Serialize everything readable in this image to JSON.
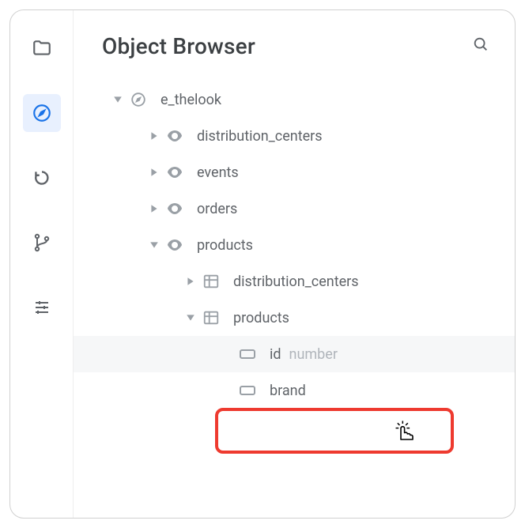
{
  "header": {
    "title": "Object Browser"
  },
  "tree": {
    "root": {
      "label": "e_thelook",
      "children": [
        {
          "label": "distribution_centers"
        },
        {
          "label": "events"
        },
        {
          "label": "orders"
        },
        {
          "label": "products",
          "children": [
            {
              "label": "distribution_centers"
            },
            {
              "label": "products",
              "fields": [
                {
                  "label": "id",
                  "type": "number"
                },
                {
                  "label": "brand"
                }
              ]
            }
          ]
        }
      ]
    }
  }
}
